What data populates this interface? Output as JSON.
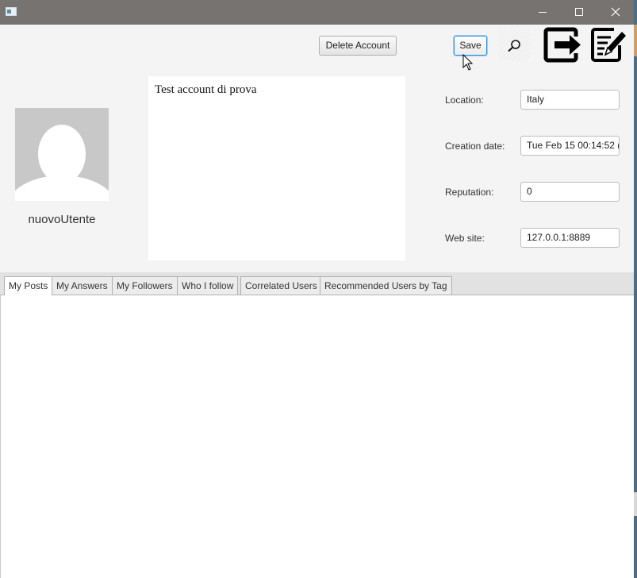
{
  "window": {
    "minimize": "minimize",
    "maximize": "maximize",
    "close": "close"
  },
  "toolbar": {
    "delete_label": "Delete Account",
    "save_label": "Save",
    "search_icon": "search-icon",
    "logout_icon": "logout-icon",
    "edit_icon": "edit-icon"
  },
  "profile": {
    "username": "nuovoUtente",
    "bio": "Test account di prova"
  },
  "fields": {
    "location_label": "Location:",
    "location_value": "Italy",
    "creation_label": "Creation date:",
    "creation_value": "Tue Feb 15 00:14:52 (",
    "reputation_label": "Reputation:",
    "reputation_value": "0",
    "website_label": "Web site:",
    "website_value": "127.0.0.1:8889"
  },
  "tabs": [
    {
      "label": "My Posts",
      "active": true
    },
    {
      "label": "My Answers",
      "active": false
    },
    {
      "label": "My Followers",
      "active": false
    },
    {
      "label": "Who I follow",
      "active": false
    },
    {
      "label": "Correlated Users",
      "active": false
    },
    {
      "label": "Recommended Users by Tag",
      "active": false
    }
  ],
  "colors": {
    "titlebar": "#777371",
    "accent": "#2b8fd6"
  }
}
